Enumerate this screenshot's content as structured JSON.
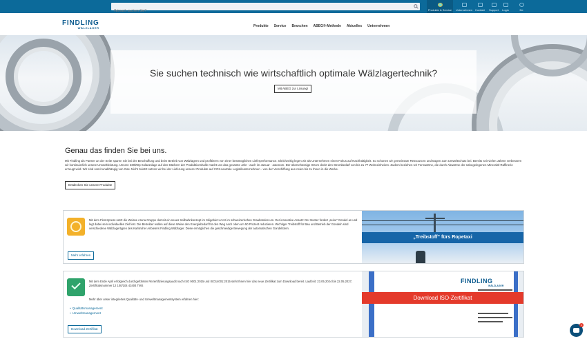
{
  "topbar": {
    "search_placeholder": "Wonach suchen Sie?",
    "items": [
      {
        "label": "Produkte & Service",
        "icon": "bearing-icon"
      },
      {
        "label": "Unternehmen",
        "icon": "headset-icon"
      },
      {
        "label": "Kontakt",
        "icon": "phone-icon"
      },
      {
        "label": "Support",
        "icon": "grid-icon"
      },
      {
        "label": "Login",
        "icon": "user-icon"
      },
      {
        "label": "De",
        "icon": "globe-icon"
      }
    ]
  },
  "header": {
    "logo_main": "FINDLING",
    "logo_sub": "WÄLZLAGER",
    "nav": [
      "Produkte",
      "Service",
      "Branchen",
      "ABEG®-Methode",
      "Aktuelles",
      "Unternehmen"
    ]
  },
  "hero": {
    "title": "Sie suchen technisch wie wirtschaftlich optimale Wälzlagertechnik?",
    "button": "Mit ABEG zur Lösung!"
  },
  "intro": {
    "heading": "Genau das finden Sie bei uns.",
    "text": "Mit Findling als Partner an der Seite sparen Sie bei der Beschaffung und beim Betrieb von Wälzlagern und profitieren von einer bestmöglichen Lieferperformance. Gleichzeitig legen wir als Unternehmen einen Fokus auf Nachhaltigkeit. So schonen wir gemeinsam Ressourcen und tragen zum Umweltschutz bei. Bereits seit vielen Jahren verbessern wir kontinuierlich unsere Umweltleistung. Unsere 230kWp Solaranlage auf den Dächern der Produktionshalle macht uns das gesamte Jahr - auch im Januar - autonom. Der überschüssige Strom deckt den Strombedarf von bis zu 77 Wohneinheiten. Zudem beziehen wir Fernwärme, die durch Abwärme der nahegelegenen Mineralöl-Raffinerie erzeugt wird. Wir sind somit unabhängig von Gas. Nicht zuletzt setzen wir bei der Lieferung unserer Produkte auf CO2-neutrale Logistikunternehmen - von der Verschiffung aus Asien bis zu Ihnen in die Werke.",
    "button": "Entdecken Sie unsere Produkte"
  },
  "card1": {
    "text": "Mit dem FlemXpress setzt die Weisse Arena Gruppe derzeit ein neues Seilbahnkonzept im Skigebiet LAAX im schweizerischen Graubünden um. Der innovative Ansatz: Der Nutzer fordert „seine“ Gondel an und legt dabei sein individuelles Ziel fest. Die Betreiber wollen auf diese Weise den Energiebedarf für den Weg nach oben um 50 Prozent reduzieren. Wichtiger Treibstoff für Bau und Betrieb der Gondeln sind verschiedene Wälzlagertypen des Karlsruher Anbieters Findling Wälzlager. Diese ermöglichen die geschmeidige Bewegung der automatischen Gondeltüren.",
    "button": "Mehr erfahren",
    "image_banner": "„Treibstoff“ fürs Ropetaxi"
  },
  "card2": {
    "text": "Mit dem Ende April erfolgreich durchgeführten Rezertifizierungsaudit nach ISO 9001:2015 und ISO14001:2015 steht Ihnen hier das neue Zertifikat zum Download bereit. Laufzeit: 23.05.2024 bis 22.05.2027, Zertifikatsnummer 12 100/104 43404 TMS",
    "sub": "Mehr über unser integriertes Qualitäts- und Umweltmanagementsystem erfahren hier:",
    "links": [
      "Qualitätsmanagement",
      "Umweltmanagement"
    ],
    "button": "Download Zertifikat",
    "image_logo_main": "FINDLING",
    "image_logo_sub": "WÄLZLAGER",
    "image_banner": "Download ISO-Zertifikat"
  },
  "chat": {
    "badge": "1"
  }
}
